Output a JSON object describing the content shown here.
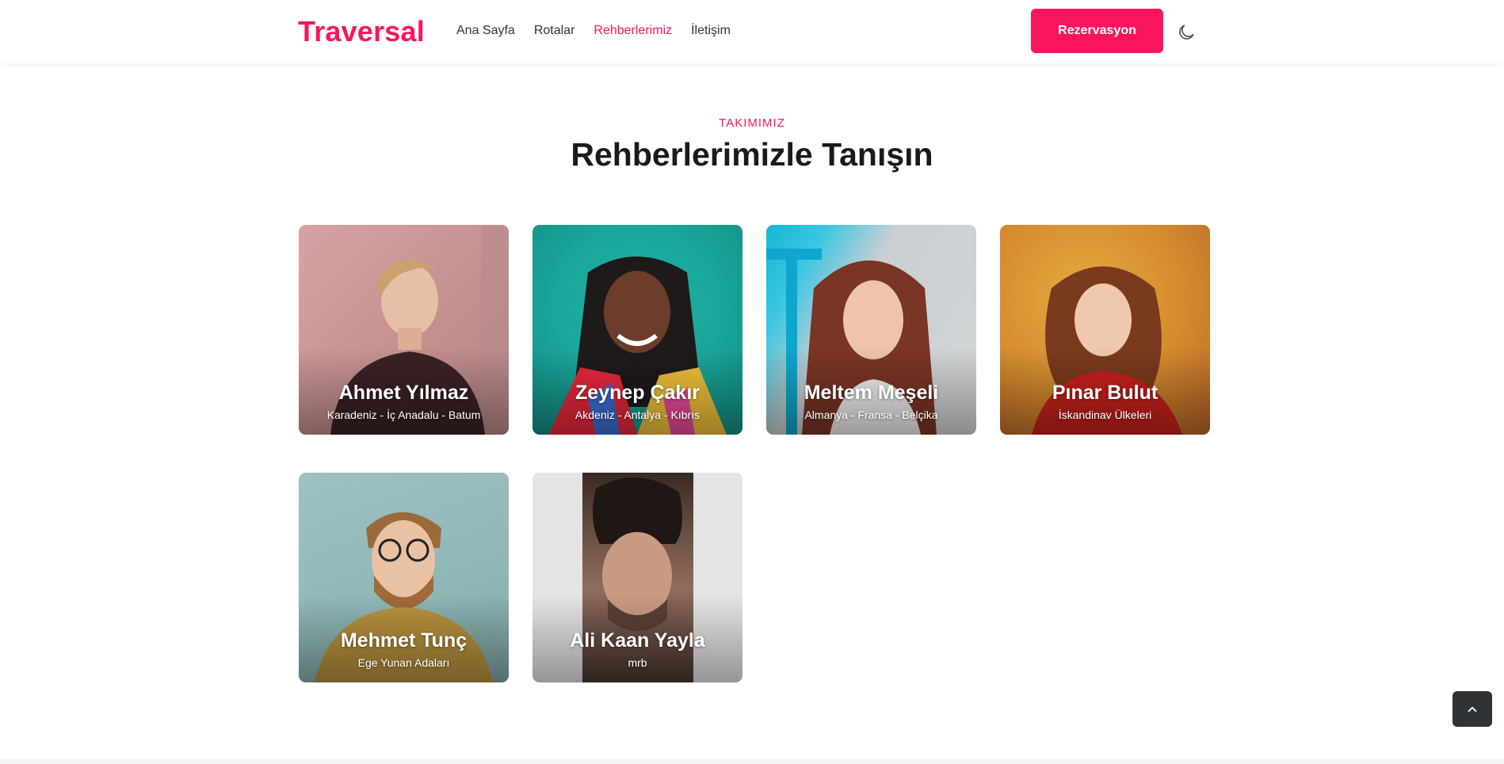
{
  "brand": {
    "name": "Traversal",
    "color": "#f5175e"
  },
  "nav": {
    "items": [
      {
        "label": "Ana Sayfa",
        "active": false
      },
      {
        "label": "Rotalar",
        "active": false
      },
      {
        "label": "Rehberlerimiz",
        "active": true
      },
      {
        "label": "İletişim",
        "active": false
      }
    ]
  },
  "header": {
    "reserve_label": "Rezervasyon",
    "theme_icon": "moon-icon"
  },
  "section": {
    "eyebrow": "TAKIMIMIZ",
    "title": "Rehberlerimizle Tanışın"
  },
  "guides": [
    {
      "name": "Ahmet Yılmaz",
      "regions": "Karadeniz - İç Anadalu - Batum"
    },
    {
      "name": "Zeynep Çakır",
      "regions": "Akdeniz - Antalya - Kıbrıs"
    },
    {
      "name": "Meltem Meşeli",
      "regions": "Almanya - Fransa - Belçika"
    },
    {
      "name": "Pınar Bulut",
      "regions": "İskandinav Ülkeleri"
    },
    {
      "name": "Mehmet Tunç",
      "regions": "Ege Yunan Adaları"
    },
    {
      "name": "Ali Kaan Yayla",
      "regions": "mrb"
    }
  ],
  "scroll_top_icon": "chevron-up-icon",
  "colors": {
    "accent": "#fb155c",
    "dark_button": "#2f3335"
  }
}
